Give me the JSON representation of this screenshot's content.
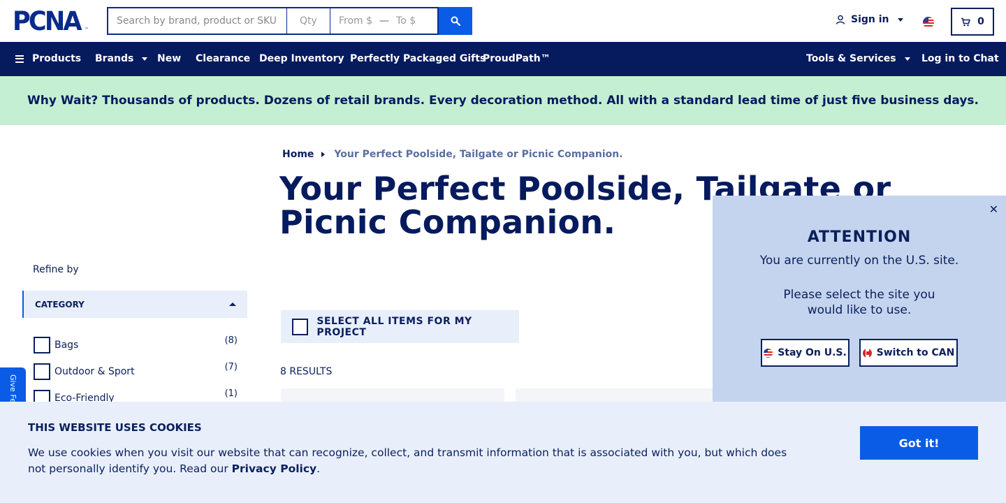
{
  "header": {
    "logo_text": "PCNA",
    "logo_tm": "™",
    "search_placeholder": "Search by brand, product or SKU",
    "qty_placeholder": "Qty",
    "price_from_placeholder": "From $",
    "price_to_placeholder": "To $",
    "signin_label": "Sign in",
    "cart_count": "0"
  },
  "nav": {
    "products": "Products",
    "brands": "Brands",
    "new": "New",
    "clearance": "Clearance",
    "deep_inventory": "Deep Inventory",
    "gifts": "Perfectly Packaged Gifts",
    "proudpath": "ProudPath™",
    "tools": "Tools & Services",
    "chat": "Log in to Chat"
  },
  "promo": {
    "text": "Why Wait? Thousands of products. Dozens of retail brands. Every decoration method. All with a standard lead time of just five business days."
  },
  "breadcrumb": {
    "home": "Home",
    "current": "Your Perfect Poolside, Tailgate or Picnic Companion."
  },
  "page_title": "Your Perfect Poolside, Tailgate or Picnic Companion.",
  "sidebar": {
    "refine_label": "Refine by",
    "category_header": "CATEGORY",
    "filters": [
      {
        "label": "Bags",
        "count": "(8)"
      },
      {
        "label": "Outdoor & Sport",
        "count": "(7)"
      },
      {
        "label": "Eco-Friendly",
        "count": "(1)"
      }
    ],
    "feedback_label": "Give Feedback"
  },
  "main": {
    "select_all_label": "SELECT ALL ITEMS FOR MY PROJECT",
    "results_label": "8 RESULTS"
  },
  "attention": {
    "title": "ATTENTION",
    "line1": "You are currently on the U.S. site.",
    "line2": "Please select the site you",
    "line3": "would like to use.",
    "stay_label": "Stay On U.S.",
    "switch_label": "Switch to CAN",
    "close_glyph": "✕"
  },
  "cookie": {
    "title": "THIS WEBSITE USES COOKIES",
    "text_before": "We use cookies when you visit our website that can recognize, collect, and transmit information that is associated with you, but which does not personally identify you. Read our ",
    "link": "Privacy Policy",
    "text_after": ".",
    "button": "Got it!"
  },
  "colors": {
    "navy": "#061a5e",
    "blue": "#0a5ce6",
    "promo_bg": "#c4efd3",
    "light_bg": "#e8effb",
    "modal_bg": "#c4d4ee"
  }
}
